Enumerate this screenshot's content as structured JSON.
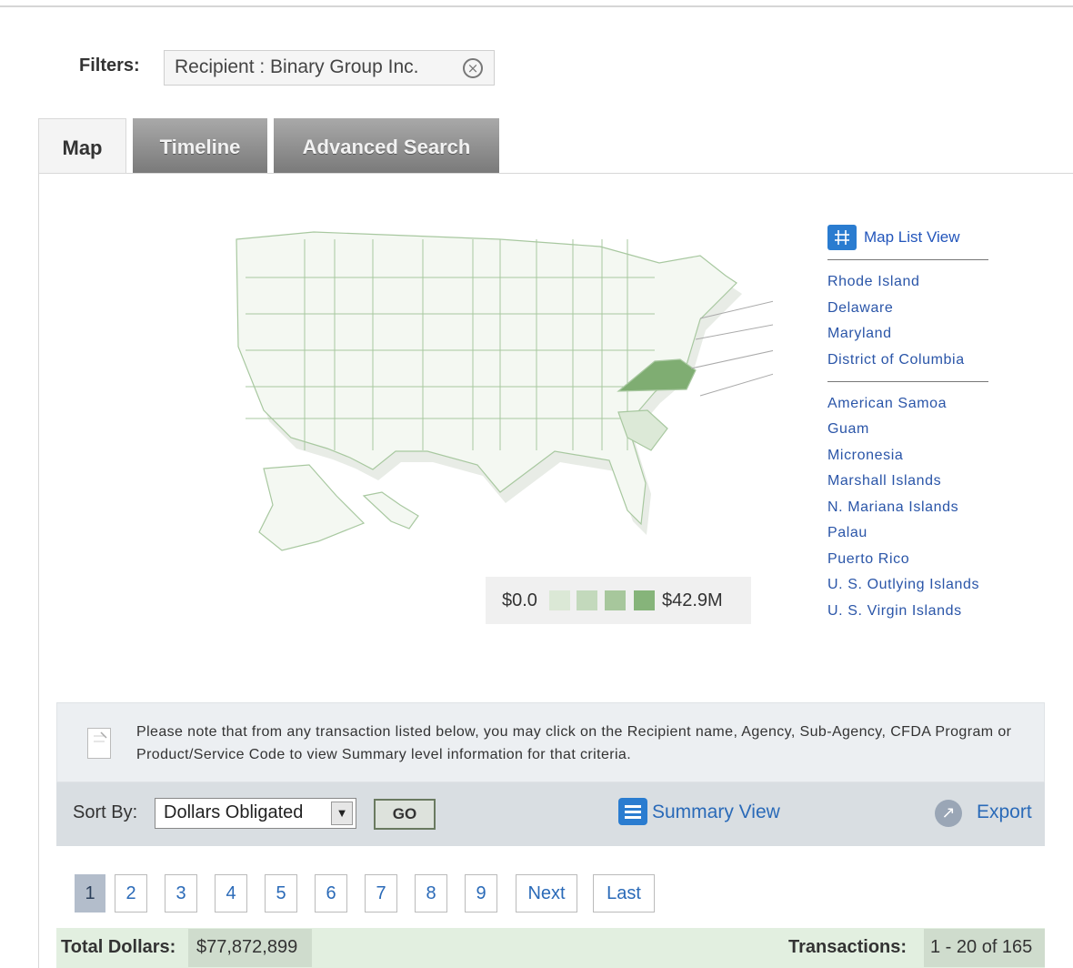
{
  "filters": {
    "label": "Filters:",
    "chip_text": "Recipient : Binary Group Inc.",
    "remove_icon": "circle-x-icon"
  },
  "tabs": [
    {
      "label": "Map",
      "active": true
    },
    {
      "label": "Timeline",
      "active": false
    },
    {
      "label": "Advanced Search",
      "active": false
    }
  ],
  "map": {
    "highlight_color": "#7fad72",
    "light_color": "#dce9d7",
    "base_color": "#f4f8f2",
    "border_color": "#a8c8a0",
    "legend": {
      "min_label": "$0.0",
      "max_label": "$42.9M",
      "swatches": [
        "#dbe8d6",
        "#c3d9bc",
        "#a7c79c",
        "#86b47a"
      ]
    }
  },
  "map_list": {
    "icon": "grid-icon",
    "link_label": "Map List View",
    "small_states": [
      "Rhode Island",
      "Delaware",
      "Maryland",
      "District of Columbia"
    ],
    "territories": [
      "American Samoa",
      "Guam",
      "Micronesia",
      "Marshall Islands",
      "N. Mariana Islands",
      "Palau",
      "Puerto Rico",
      "U. S. Outlying Islands",
      "U. S. Virgin Islands"
    ]
  },
  "note": {
    "icon": "note-icon",
    "text": "Please note that from any transaction listed below, you may click on the Recipient name, Agency, Sub-Agency, CFDA Program or Product/Service Code to view Summary level information for that criteria."
  },
  "sort": {
    "label": "Sort By:",
    "selected": "Dollars Obligated",
    "go_label": "GO",
    "summary_label": "Summary View",
    "summary_icon": "list-icon",
    "export_label": "Export",
    "export_icon": "arrow-out-icon"
  },
  "pagination": {
    "pages": [
      "1",
      "2",
      "3",
      "4",
      "5",
      "6",
      "7",
      "8",
      "9"
    ],
    "current": "1",
    "next_label": "Next",
    "last_label": "Last"
  },
  "totals": {
    "total_label": "Total Dollars:",
    "total_value": "$77,872,899",
    "transactions_label": "Transactions:",
    "transactions_value": "1 - 20 of 165"
  }
}
